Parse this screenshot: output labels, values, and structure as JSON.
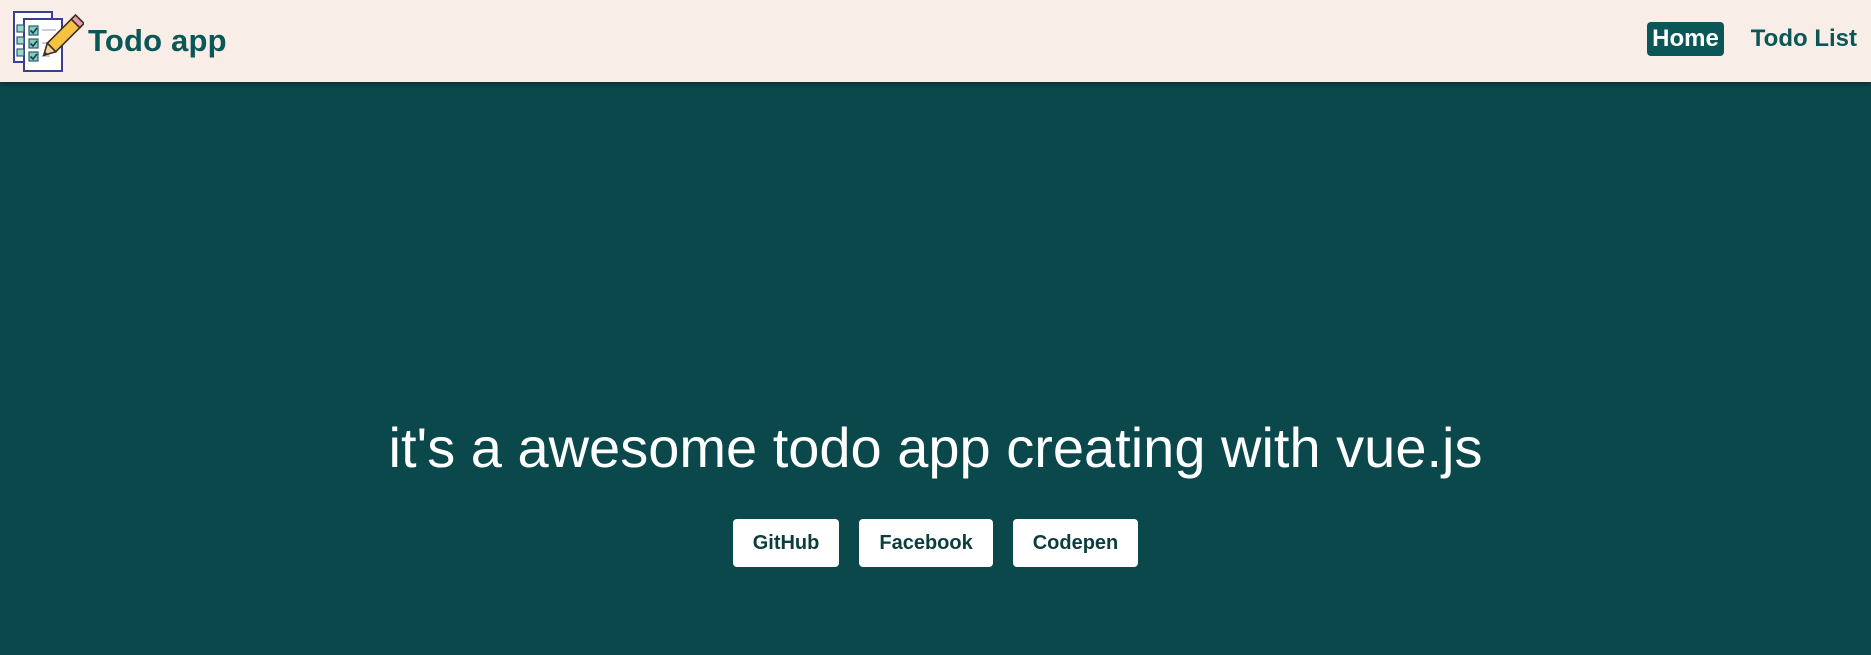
{
  "navbar": {
    "brand": {
      "icon": "todo-checklist-pencil-icon",
      "title": "Todo app"
    },
    "links": [
      {
        "label": "Home",
        "active": true
      },
      {
        "label": "Todo List",
        "active": false
      }
    ]
  },
  "hero": {
    "title": "it's a awesome todo app creating with vue.js",
    "buttons": [
      {
        "label": "GitHub"
      },
      {
        "label": "Facebook"
      },
      {
        "label": "Codepen"
      }
    ]
  },
  "colors": {
    "navbar_bg": "#f8eee7",
    "brand_teal": "#0b5656",
    "hero_bg": "#0b484b",
    "button_bg": "#ffffff",
    "button_text": "#0b3d3f"
  }
}
